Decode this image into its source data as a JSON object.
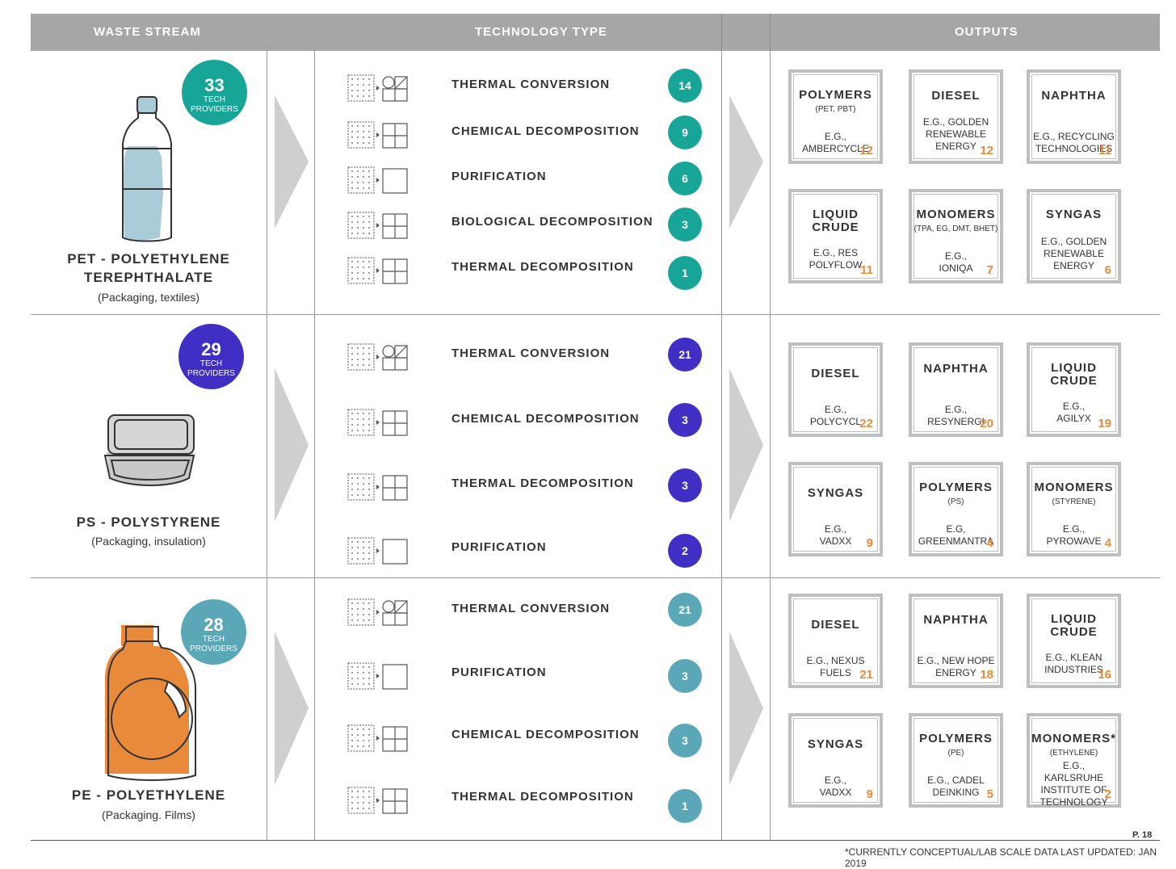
{
  "header": {
    "waste_stream": "WASTE STREAM",
    "technology_type": "TECHNOLOGY TYPE",
    "outputs": "OUTPUTS"
  },
  "colors": {
    "teal": "#17a598",
    "purple": "#3f2fc4",
    "steel": "#5aa7b8",
    "orange": "#e98a3a",
    "header_gray": "#a6a6a6"
  },
  "badge_label": "TECH\nPROVIDERS",
  "streams": [
    {
      "name_line1": "PET - POLYETHYLENE",
      "name_line2": "TEREPHTHALATE",
      "sub": "(Packaging, textiles)",
      "providers": "33",
      "badge_label_1": "TECH",
      "badge_label_2": "PROVIDERS",
      "icon": "plastic-bottle-icon",
      "technologies": [
        {
          "label": "THERMAL CONVERSION",
          "count": "14",
          "icon": "thermal-conversion-icon"
        },
        {
          "label": "CHEMICAL DECOMPOSITION",
          "count": "9",
          "icon": "decomposition-icon"
        },
        {
          "label": "PURIFICATION",
          "count": "6",
          "icon": "purification-icon"
        },
        {
          "label": "BIOLOGICAL DECOMPOSITION",
          "count": "3",
          "icon": "decomposition-icon"
        },
        {
          "label": "THERMAL DECOMPOSITION",
          "count": "1",
          "icon": "decomposition-icon"
        }
      ],
      "outputs": [
        {
          "title": "POLYMERS",
          "sub": "(PET, PBT)",
          "eg": "E.G.,\nAMBERCYCLE",
          "count": "12"
        },
        {
          "title": "DIESEL",
          "sub": "",
          "eg": "E.G., GOLDEN\nRENEWABLE\nENERGY",
          "count": "12"
        },
        {
          "title": "NAPHTHA",
          "sub": "",
          "eg": "E.G., RECYCLING\nTECHNOLOGIES",
          "count": "11"
        },
        {
          "title": "LIQUID\nCRUDE",
          "sub": "",
          "eg": "E.G., RES\nPOLYFLOW",
          "count": "11"
        },
        {
          "title": "MONOMERS",
          "sub": "(TPA, EG, DMT, BHET)",
          "eg": "E.G.,\nIONIQA",
          "count": "7"
        },
        {
          "title": "SYNGAS",
          "sub": "",
          "eg": "E.G., GOLDEN\nRENEWABLE\nENERGY",
          "count": "6"
        }
      ]
    },
    {
      "name_line1": "PS - POLYSTYRENE",
      "name_line2": "",
      "sub": "(Packaging, insulation)",
      "providers": "29",
      "badge_label_1": "TECH",
      "badge_label_2": "PROVIDERS",
      "icon": "foam-container-icon",
      "technologies": [
        {
          "label": "THERMAL CONVERSION",
          "count": "21",
          "icon": "thermal-conversion-icon"
        },
        {
          "label": "CHEMICAL DECOMPOSITION",
          "count": "3",
          "icon": "decomposition-icon"
        },
        {
          "label": "THERMAL DECOMPOSITION",
          "count": "3",
          "icon": "decomposition-icon"
        },
        {
          "label": "PURIFICATION",
          "count": "2",
          "icon": "purification-icon"
        }
      ],
      "outputs": [
        {
          "title": "DIESEL",
          "sub": "",
          "eg": "E.G.,\nPOLYCYCL",
          "count": "22"
        },
        {
          "title": "NAPHTHA",
          "sub": "",
          "eg": "E.G.,\nRESYNERGI",
          "count": "20"
        },
        {
          "title": "LIQUID\nCRUDE",
          "sub": "",
          "eg": "E.G.,\nAGILYX",
          "count": "19"
        },
        {
          "title": "SYNGAS",
          "sub": "",
          "eg": "E.G.,\nVADXX",
          "count": "9"
        },
        {
          "title": "POLYMERS",
          "sub": "(PS)",
          "eg": "E.G,\nGREENMANTRA",
          "count": "4"
        },
        {
          "title": "MONOMERS",
          "sub": "(STYRENE)",
          "eg": "E.G.,\nPYROWAVE",
          "count": "4"
        }
      ]
    },
    {
      "name_line1": "PE - POLYETHYLENE",
      "name_line2": "",
      "sub": "(Packaging. Films)",
      "providers": "28",
      "badge_label_1": "TECH",
      "badge_label_2": "PROVIDERS",
      "icon": "detergent-jug-icon",
      "technologies": [
        {
          "label": "THERMAL CONVERSION",
          "count": "21",
          "icon": "thermal-conversion-icon"
        },
        {
          "label": "PURIFICATION",
          "count": "3",
          "icon": "purification-icon"
        },
        {
          "label": "CHEMICAL DECOMPOSITION",
          "count": "3",
          "icon": "decomposition-icon"
        },
        {
          "label": "THERMAL DECOMPOSITION",
          "count": "1",
          "icon": "decomposition-icon"
        }
      ],
      "outputs": [
        {
          "title": "DIESEL",
          "sub": "",
          "eg": "E.G., NEXUS\nFUELS",
          "count": "21"
        },
        {
          "title": "NAPHTHA",
          "sub": "",
          "eg": "E.G., NEW HOPE\nENERGY",
          "count": "18"
        },
        {
          "title": "LIQUID\nCRUDE",
          "sub": "",
          "eg": "E.G., KLEAN\nINDUSTRIES",
          "count": "16"
        },
        {
          "title": "SYNGAS",
          "sub": "",
          "eg": "E.G.,\nVADXX",
          "count": "9"
        },
        {
          "title": "POLYMERS",
          "sub": "(PE)",
          "eg": "E.G., CADEL\nDEINKING",
          "count": "5"
        },
        {
          "title": "MONOMERS*",
          "sub": "(ETHYLENE)",
          "eg": "E.G., KARLSRUHE\nINSTITUTE OF\nTECHNOLOGY",
          "count": "2"
        }
      ]
    }
  ],
  "footer": {
    "page": "P. 18",
    "note": "*CURRENTLY CONCEPTUAL/LAB SCALE DATA LAST UPDATED: JAN 2019"
  }
}
